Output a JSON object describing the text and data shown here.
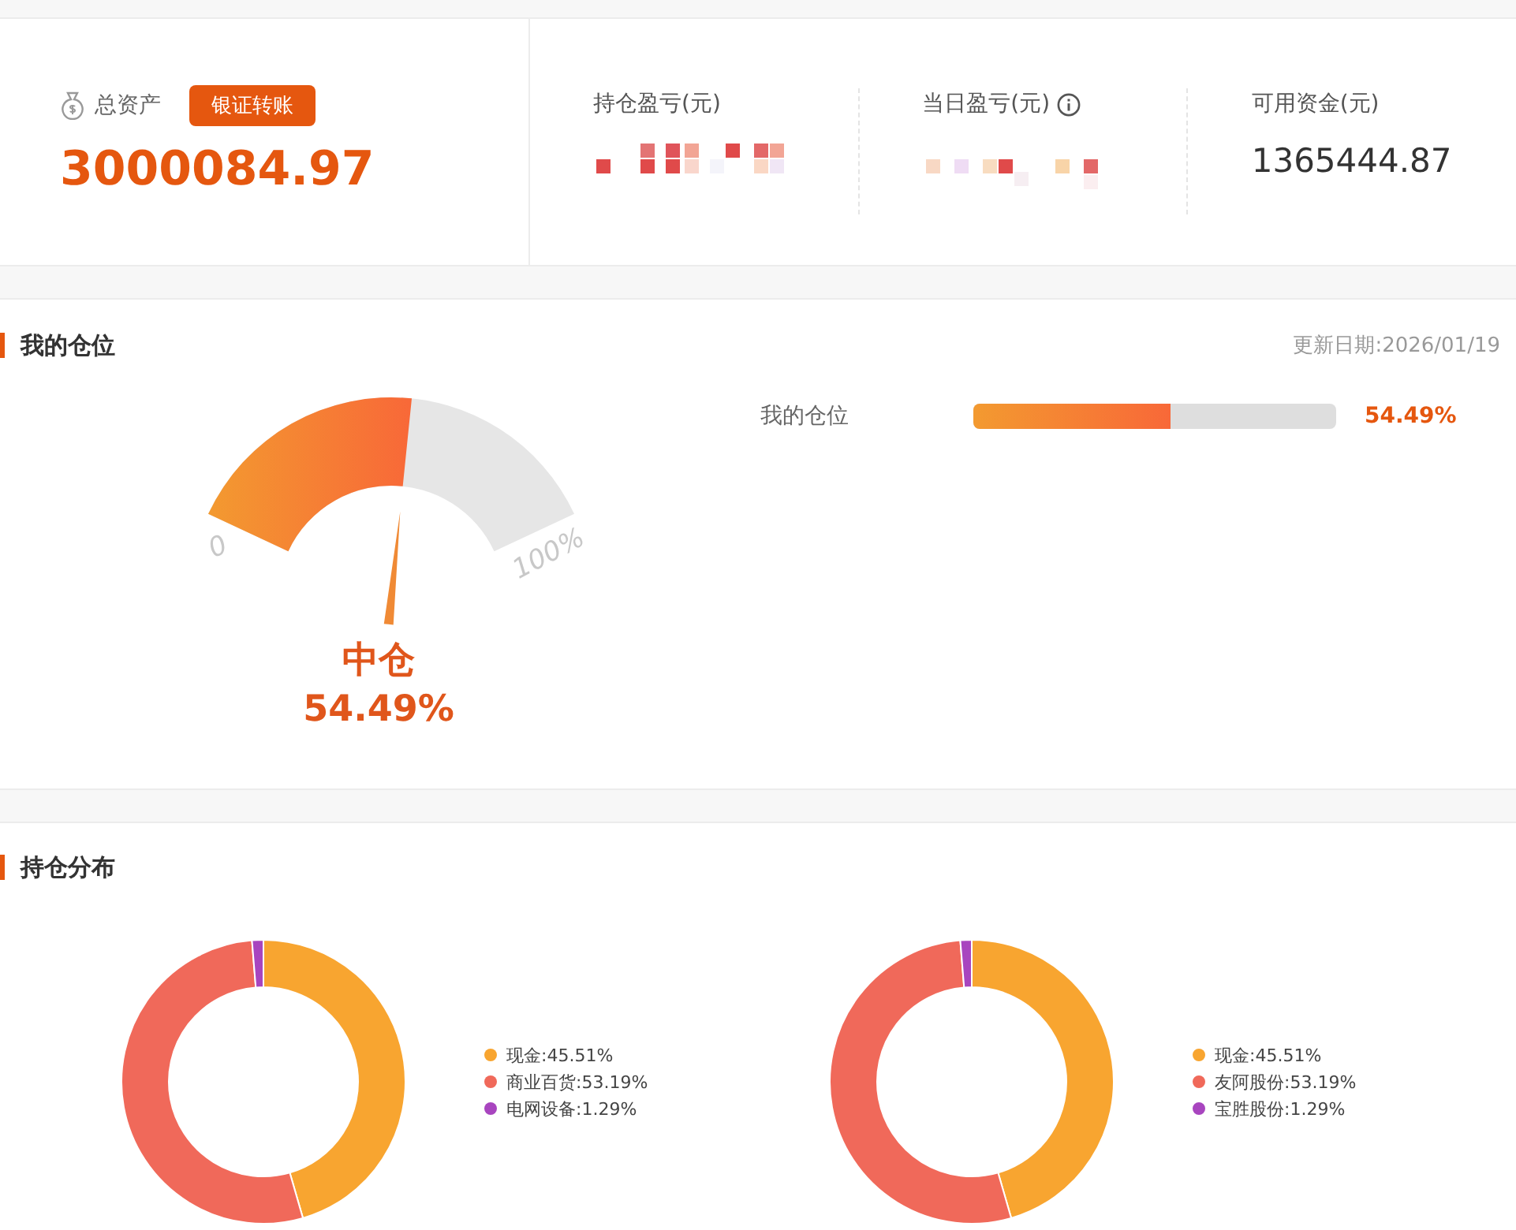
{
  "summary": {
    "total_assets": {
      "label": "总资产",
      "button": "银证转账",
      "value": "3000084.97"
    },
    "metrics": [
      {
        "label": "持仓盈亏(元)",
        "kind": "masked",
        "info": false
      },
      {
        "label": "当日盈亏(元)",
        "kind": "masked",
        "info": true
      },
      {
        "label": "可用资金(元)",
        "kind": "value",
        "info": false,
        "value": "1365444.87"
      }
    ]
  },
  "position": {
    "title": "我的仓位",
    "update_date": "更新日期:2026/01/19",
    "gauge": {
      "level": 0.5449,
      "min_label": "0",
      "max_label": "100%",
      "status": "中仓",
      "reading": "54.49%"
    },
    "bar": {
      "label": "我的仓位",
      "level": 0.5449,
      "reading": "54.49%"
    }
  },
  "distribution": {
    "title": "持仓分布",
    "charts": [
      {
        "chart_data": {
          "type": "donut",
          "categories": [
            "现金:45.51%",
            "商业百货:53.19%",
            "电网设备:1.29%"
          ],
          "values": [
            45.51,
            53.19,
            1.29
          ]
        },
        "legend": [
          {
            "color": "#f8a530"
          },
          {
            "color": "#f0695a"
          },
          {
            "color": "#a845bf"
          }
        ]
      },
      {
        "chart_data": {
          "type": "donut",
          "categories": [
            "现金:45.51%",
            "友阿股份:53.19%",
            "宝胜股份:1.29%"
          ],
          "values": [
            45.51,
            53.19,
            1.29
          ]
        },
        "legend": [
          {
            "color": "#f8a530"
          },
          {
            "color": "#f0695a"
          },
          {
            "color": "#a845bf"
          }
        ]
      }
    ]
  }
}
